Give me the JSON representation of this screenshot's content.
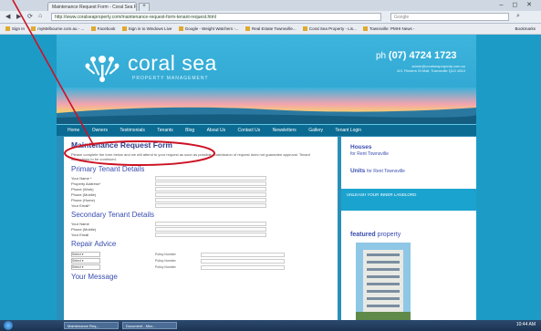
{
  "browser": {
    "tab_title": "Maintenance Request Form - Coral Sea P...",
    "new_tab": "+",
    "window_controls": "– ◻ ✕",
    "back": "◀",
    "forward": "▶",
    "url": "http://www.coralseaproperty.com/maintenance-request-form-tenant-request.html",
    "search_placeholder": "Google",
    "bookmarks": [
      "Sign In",
      "myMelbourne.com.au - ...",
      "Facebook",
      "Sign in to Windows Live",
      "Google - Weight Watchers -...",
      "Real Estate Townsville...",
      "Coral Sea Property - Lis...",
      "Townsville: PMHI News -",
      "Bookmarks"
    ]
  },
  "site": {
    "brand": "coral sea",
    "tagline": "PROPERTY MANAGEMENT",
    "phone_prefix": "ph",
    "phone": "(07) 4724 1723",
    "address_lines": [
      "admin@coralseaproperty.com.au",
      "421 Flinders St Mall, Townsville QLD 4810"
    ],
    "menu": [
      "Home",
      "Owners",
      "Testimonials",
      "Tenants",
      "Blog",
      "About Us",
      "Contact Us",
      "Newsletters",
      "Gallery",
      "Tenant Login"
    ]
  },
  "form": {
    "title": "Maintenance Request Form",
    "intro": "Please complete the form below and we will attend to your request as soon as possible. Submission of request does not guarantee approval. Tenant instructions to be continued.",
    "primary_heading": "Primary Tenant Details",
    "primary_fields": [
      "Your Name *",
      "Property Address*",
      "Phone (Work)",
      "Phone (Mobile)",
      "Phone (Home)",
      "Your Email*"
    ],
    "secondary_heading": "Secondary Tenant Details",
    "secondary_fields": [
      "Your Name",
      "Phone (Mobile)",
      "Your Email"
    ],
    "repair_heading": "Repair Advice",
    "repair_selects": [
      "Select",
      "Select",
      "Select"
    ],
    "repair_labels": [
      "Policy Number",
      "Policy Number",
      "Policy Number"
    ],
    "message_heading": "Your Message"
  },
  "sidebar": {
    "houses_label": "Houses",
    "houses_sub": "for Rent Townsville",
    "units_label": "Units",
    "units_sub": "for Rent Townsville",
    "promo": "UNLEASH YOUR INNER LANDLORD",
    "featured_bold": "featured",
    "featured_rest": "property"
  },
  "taskbar": {
    "items": [
      "Maintenance Req...",
      "Document - Micr..."
    ],
    "clock": "10:44 AM"
  },
  "colors": {
    "annotation": "#cc1122",
    "site_blue": "#1d9bc7",
    "heading_blue": "#3a4db0"
  }
}
